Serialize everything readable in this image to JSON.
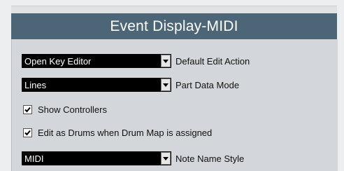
{
  "header": {
    "title": "Event Display-MIDI"
  },
  "settings": {
    "default_edit_action": {
      "value": "Open Key Editor",
      "label": "Default Edit Action"
    },
    "part_data_mode": {
      "value": "Lines",
      "label": "Part Data Mode"
    },
    "show_controllers": {
      "checked": true,
      "label": "Show Controllers"
    },
    "edit_as_drums": {
      "checked": true,
      "label": "Edit as Drums when Drum Map is assigned"
    },
    "note_name_style": {
      "value": "MIDI",
      "label": "Note Name Style"
    }
  },
  "icons": {
    "dropdown": "chevron-down-icon",
    "checkmark": "checkmark-icon"
  }
}
